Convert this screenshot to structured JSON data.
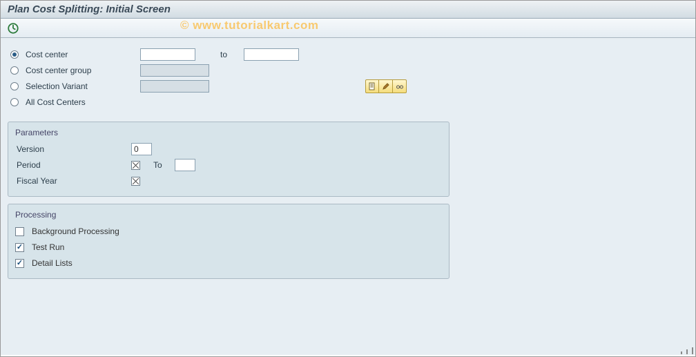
{
  "title": "Plan Cost Splitting: Initial Screen",
  "watermark": "© www.tutorialkart.com",
  "selection": {
    "radios": {
      "cost_center": "Cost center",
      "cost_center_group": "Cost center group",
      "selection_variant": "Selection Variant",
      "all_cost_centers": "All Cost Centers"
    },
    "selected": "cost_center",
    "cost_center_from": "",
    "to_label": "to",
    "cost_center_to": "",
    "cost_center_group_value": "",
    "selection_variant_value": ""
  },
  "parameters": {
    "title": "Parameters",
    "version_label": "Version",
    "version_value": "0",
    "period_label": "Period",
    "period_from": "",
    "period_to_label": "To",
    "period_to": "",
    "fiscal_year_label": "Fiscal Year",
    "fiscal_year_value": ""
  },
  "processing": {
    "title": "Processing",
    "background_label": "Background Processing",
    "background_checked": false,
    "test_run_label": "Test Run",
    "test_run_checked": true,
    "detail_lists_label": "Detail Lists",
    "detail_lists_checked": true
  },
  "icons": {
    "execute": "execute-icon",
    "create_variant": "document-icon",
    "change_variant": "pencil-icon",
    "display_variant": "glasses-icon"
  }
}
